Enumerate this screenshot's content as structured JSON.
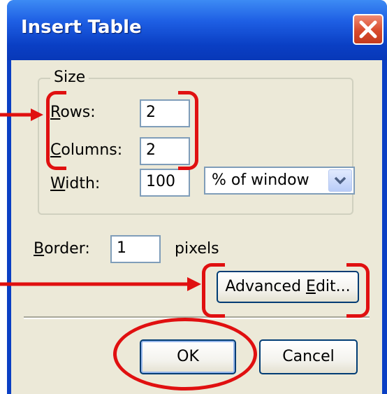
{
  "dialog": {
    "title": "Insert Table",
    "close_icon": "close-x-icon"
  },
  "size_group": {
    "legend": "Size",
    "rows_label": {
      "pre": "",
      "key": "R",
      "post": "ows:"
    },
    "rows_value": "2",
    "columns_label": {
      "pre": "",
      "key": "C",
      "post": "olumns:"
    },
    "columns_value": "2",
    "width_label": {
      "pre": "",
      "key": "W",
      "post": "idth:"
    },
    "width_value": "100",
    "width_unit_selected": "% of window"
  },
  "border": {
    "label": {
      "pre": "",
      "key": "B",
      "post": "order:"
    },
    "value": "1",
    "unit": "pixels"
  },
  "buttons": {
    "advanced_edit": {
      "pre": "Advanced ",
      "key": "E",
      "post": "dit..."
    },
    "ok": "OK",
    "cancel": "Cancel"
  },
  "annotation_color": "#e01010"
}
